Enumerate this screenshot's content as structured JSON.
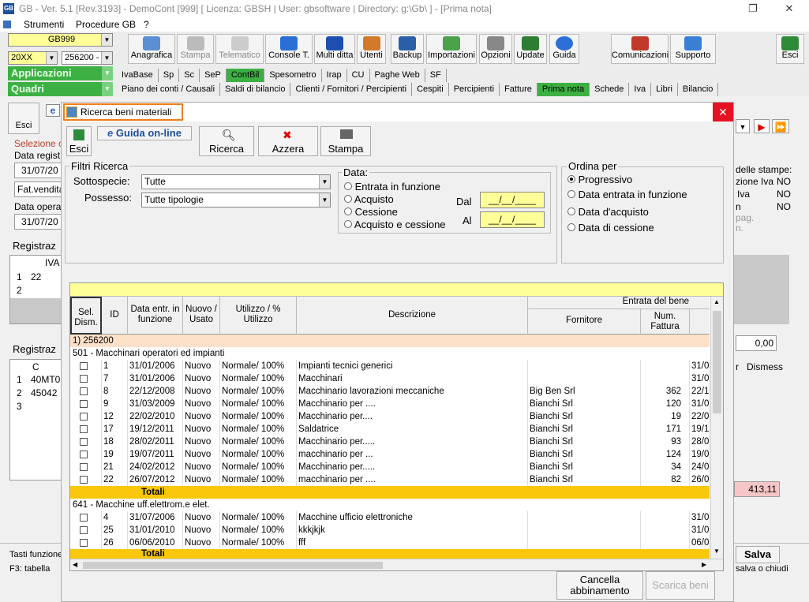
{
  "window": {
    "title": "GB - Ver. 5.1 [Rev.3193] -  DemoCont [999]    [ Licenza: GBSH | User: gbsoftware | Directory: g:\\Gb\\ ] - [Prima nota]",
    "logo": "GB"
  },
  "menu": [
    "Strumenti",
    "Procedure GB",
    "?"
  ],
  "left": {
    "company": "GB999",
    "year": "20XX",
    "code": "256200 -",
    "apps": "Applicazioni",
    "quadri": "Quadri"
  },
  "toolbar": [
    "Anagrafica",
    "Stampa",
    "Telematico",
    "Console T.",
    "Multi ditta",
    "Utenti",
    "Backup",
    "Importazioni",
    "Opzioni",
    "Update",
    "Guida"
  ],
  "toolbar_right": [
    "Comunicazioni",
    "Supporto",
    "Esci"
  ],
  "tabs1": [
    "IvaBase",
    "Sp",
    "Sc",
    "SeP",
    "ContBil",
    "Spesometro",
    "Irap",
    "CU",
    "Paghe Web",
    "SF"
  ],
  "tabs2": [
    "Piano dei conti / Causali",
    "Saldi di bilancio",
    "Clienti / Fornitori / Percipienti",
    "Cespiti",
    "Percipienti",
    "Fatture",
    "Prima nota",
    "Schede",
    "Iva",
    "Libri",
    "Bilancio"
  ],
  "bg": {
    "esci": "Esci",
    "selezione": "Selezione c",
    "data_reg": "Data regist",
    "date1": "31/07/20",
    "fat": "Fat.vendita",
    "data_op": "Data opera",
    "date2": "31/07/20",
    "registraz1": "Registraz",
    "iva": "IVA",
    "r1": "1",
    "v22": "22",
    "r2": "2",
    "registraz2": "Registraz",
    "c": "C",
    "rr1": "1",
    "rr2": "2",
    "rr3": "3",
    "code1": "40MT0",
    "code2": "45042",
    "total": "0,00",
    "amount": "413,11",
    "r_label": "r",
    "dismesso": "Dismess",
    "stampe": "delle stampe:",
    "zione_iva": "zione Iva",
    "no1": "NO",
    "iva2": "Iva",
    "no2": "NO",
    "n": "n",
    "no3": "NO",
    "pag": "pag.",
    "nn": "n.",
    "tasti": "Tasti funzione",
    "f3": "F3: tabella",
    "salva": "Salva",
    "salva_chiudi": "salva o chiudi",
    "badge_e": "e"
  },
  "dialog": {
    "title": "Ricerca beni materiali",
    "esci": "Esci",
    "guida": "Guida on-line",
    "ricerca": "Ricerca",
    "azzera": "Azzera",
    "stampa": "Stampa",
    "filtri": "Filtri Ricerca",
    "sottospecie_label": "Sottospecie:",
    "sottospecie_value": "Tutte",
    "possesso_label": "Possesso:",
    "possesso_value": "Tutte tipologie",
    "data_label": "Data:",
    "data_opts": [
      "Entrata in funzione",
      "Acquisto",
      "Cessione",
      "Acquisto e cessione"
    ],
    "dal": "Dal",
    "al": "Al",
    "date_ph": "__/__/____",
    "ordina": "Ordina per",
    "ordina_opts": [
      "Progressivo",
      "Data entrata in funzione",
      "Data d'acquisto",
      "Data di cessione"
    ],
    "cancella": "Cancella abbinamento",
    "scarica": "Scarica beni"
  },
  "grid": {
    "headers": {
      "sel": "Sel. Dism.",
      "id": "ID",
      "data": "Data entr. in funzione",
      "nuovo": "Nuovo / Usato",
      "utilizzo": "Utilizzo / % Utilizzo",
      "descrizione": "Descrizione",
      "entrata": "Entrata del bene",
      "fornitore": "Fornitore",
      "num": "Num. Fattura"
    },
    "group1": "1) 256200",
    "sub1": "501 - Macchinari operatori ed impianti",
    "rows1": [
      {
        "id": "1",
        "date": "31/01/2006",
        "nu": "Nuovo",
        "ut": "Normale/ 100%",
        "desc": "Impianti tecnici generici",
        "forn": "",
        "num": "",
        "d2": "31/0"
      },
      {
        "id": "7",
        "date": "31/01/2006",
        "nu": "Nuovo",
        "ut": "Normale/ 100%",
        "desc": "Macchinari",
        "forn": "",
        "num": "",
        "d2": "31/0"
      },
      {
        "id": "8",
        "date": "22/12/2008",
        "nu": "Nuovo",
        "ut": "Normale/ 100%",
        "desc": "Macchinario lavorazioni meccaniche",
        "forn": "Big Ben Srl",
        "num": "362",
        "d2": "22/1"
      },
      {
        "id": "9",
        "date": "31/03/2009",
        "nu": "Nuovo",
        "ut": "Normale/ 100%",
        "desc": "Macchinario per ....",
        "forn": "Bianchi Srl",
        "num": "120",
        "d2": "31/0"
      },
      {
        "id": "12",
        "date": "22/02/2010",
        "nu": "Nuovo",
        "ut": "Normale/ 100%",
        "desc": "Macchinario per....",
        "forn": "Bianchi Srl",
        "num": "19",
        "d2": "22/0"
      },
      {
        "id": "17",
        "date": "19/12/2011",
        "nu": "Nuovo",
        "ut": "Normale/ 100%",
        "desc": "Saldatrice",
        "forn": "Bianchi Srl",
        "num": "171",
        "d2": "19/1"
      },
      {
        "id": "18",
        "date": "28/02/2011",
        "nu": "Nuovo",
        "ut": "Normale/ 100%",
        "desc": "Macchinario per.....",
        "forn": "Bianchi Srl",
        "num": "93",
        "d2": "28/0"
      },
      {
        "id": "19",
        "date": "19/07/2011",
        "nu": "Nuovo",
        "ut": "Normale/ 100%",
        "desc": "macchinario per ...",
        "forn": "Bianchi Srl",
        "num": "124",
        "d2": "19/0"
      },
      {
        "id": "21",
        "date": "24/02/2012",
        "nu": "Nuovo",
        "ut": "Normale/ 100%",
        "desc": "Macchinario per.....",
        "forn": "Bianchi Srl",
        "num": "34",
        "d2": "24/0"
      },
      {
        "id": "22",
        "date": "26/07/2012",
        "nu": "Nuovo",
        "ut": "Normale/ 100%",
        "desc": "macchinario per ....",
        "forn": "Bianchi Srl",
        "num": "82",
        "d2": "26/0"
      }
    ],
    "totali": "Totali",
    "sub2": "641 - Macchine uff.elettrom.e elet.",
    "rows2": [
      {
        "id": "4",
        "date": "31/07/2006",
        "nu": "Nuovo",
        "ut": "Normale/ 100%",
        "desc": "Macchine ufficio elettroniche",
        "forn": "",
        "num": "",
        "d2": "31/0"
      },
      {
        "id": "25",
        "date": "31/01/2010",
        "nu": "Nuovo",
        "ut": "Normale/ 100%",
        "desc": "kkkjkjk",
        "forn": "",
        "num": "",
        "d2": "31/0"
      },
      {
        "id": "26",
        "date": "06/06/2010",
        "nu": "Nuovo",
        "ut": "Normale/ 100%",
        "desc": "fff",
        "forn": "",
        "num": "",
        "d2": "06/0"
      }
    ],
    "totali2": "Totali"
  }
}
